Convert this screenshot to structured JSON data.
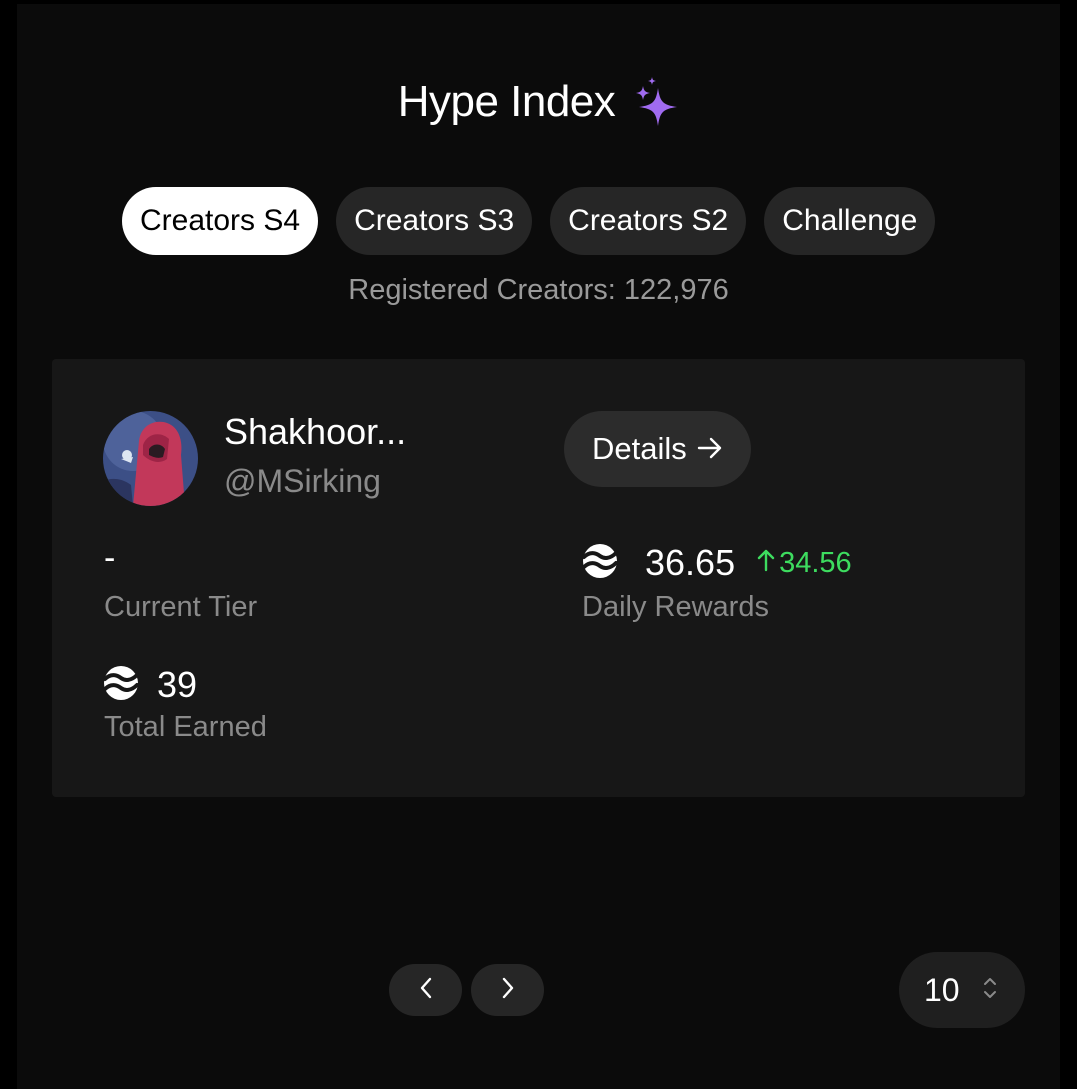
{
  "header": {
    "title": "Hype Index",
    "sparkle_icon": "sparkles-icon",
    "sparkle_color": "#a06bf0"
  },
  "tabs": [
    {
      "label": "Creators S4",
      "active": true
    },
    {
      "label": "Creators S3",
      "active": false
    },
    {
      "label": "Creators S2",
      "active": false
    },
    {
      "label": "Challenge",
      "active": false
    }
  ],
  "registered_text": "Registered Creators: 122,976",
  "creator": {
    "name": "Shakhoor...",
    "handle": "@MSirking",
    "details_label": "Details",
    "current_tier_value": "-",
    "current_tier_label": "Current Tier",
    "daily_rewards_value": "36.65",
    "daily_rewards_change": "34.56",
    "daily_rewards_label": "Daily Rewards",
    "total_earned_value": "39",
    "total_earned_label": "Total Earned"
  },
  "pagination": {
    "page_size": "10"
  },
  "colors": {
    "accent_green": "#3ddc5f",
    "active_tab_bg": "#ffffff"
  }
}
